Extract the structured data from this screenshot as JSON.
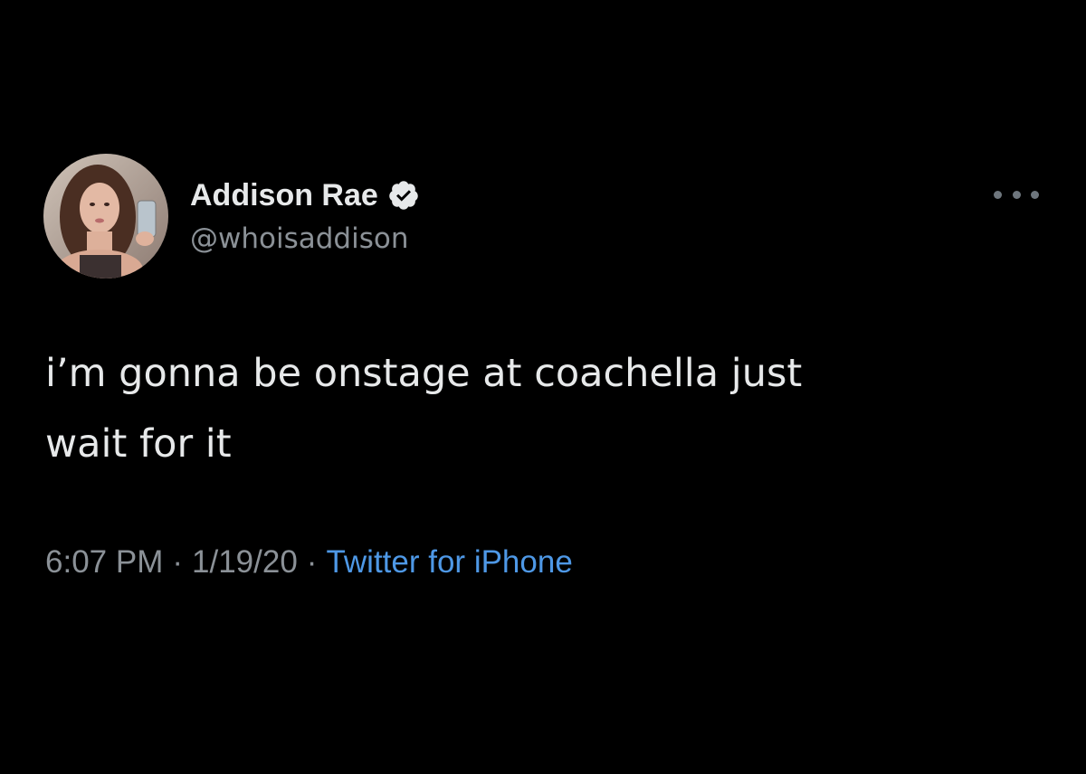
{
  "tweet": {
    "display_name": "Addison Rae",
    "handle": "@whoisaddison",
    "text_line1": "i’m gonna be onstage at coachella just",
    "text_line2": "wait for it",
    "time": "6:07 PM",
    "date": "1/19/20",
    "source": "Twitter for iPhone",
    "separator": "·"
  },
  "icons": {
    "verified": "verified-badge-icon",
    "more": "more-options-icon"
  },
  "colors": {
    "background": "#000000",
    "primary_text": "#e7e9ea",
    "secondary_text": "#8b9197",
    "link": "#4e98e6",
    "verified_badge": "#e7e9ea"
  }
}
